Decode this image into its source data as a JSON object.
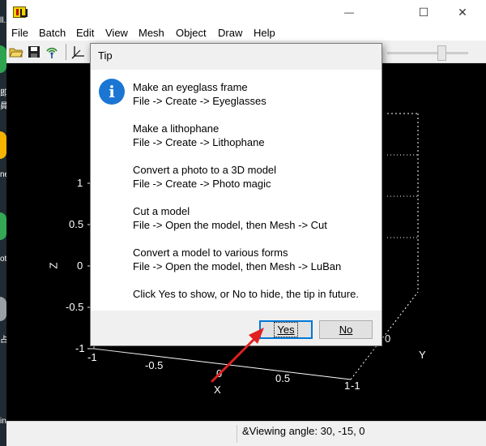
{
  "window": {
    "minimize_glyph": "—",
    "maximize_glyph": "☐",
    "close_glyph": "✕"
  },
  "desktop_labels": [
    "ll.",
    "即",
    "員",
    "ne",
    "ot",
    "占",
    "in"
  ],
  "menu": [
    "File",
    "Batch",
    "Edit",
    "View",
    "Mesh",
    "Object",
    "Draw",
    "Help"
  ],
  "toolbar": {
    "icons": [
      "open-folder-icon",
      "save-icon",
      "wireless-icon",
      "axes-icon"
    ]
  },
  "viewport": {
    "z_ticks": [
      "1",
      "0.5",
      "0",
      "-0.5",
      "-1"
    ],
    "z_label": "Z",
    "x_ticks": [
      "-1",
      "-0.5",
      "0",
      "0.5",
      "1"
    ],
    "x_label": "X",
    "y_ticks": [
      "0",
      "-1"
    ],
    "y_label": "Y"
  },
  "status": {
    "text": "&Viewing angle: 30, -15, 0"
  },
  "dialog": {
    "title": "Tip",
    "tips": [
      {
        "title": "Make an eyeglass frame",
        "path": "File -> Create -> Eyeglasses"
      },
      {
        "title": "Make a lithophane",
        "path": "File -> Create -> Lithophane"
      },
      {
        "title": "Convert a photo to a 3D model",
        "path": "File -> Create -> Photo magic"
      },
      {
        "title": "Cut a model",
        "path": "File -> Open the model, then Mesh -> Cut"
      },
      {
        "title": "Convert a model to various forms",
        "path": "File -> Open the model, then Mesh -> LuBan"
      }
    ],
    "question": "Click Yes to show, or No to hide, the tip in future.",
    "yes_label": "Yes",
    "no_label": "No"
  },
  "colors": {
    "viewport_bg": "#000000",
    "accent_blue": "#0078d7",
    "annotation_arrow": "#e02020"
  }
}
